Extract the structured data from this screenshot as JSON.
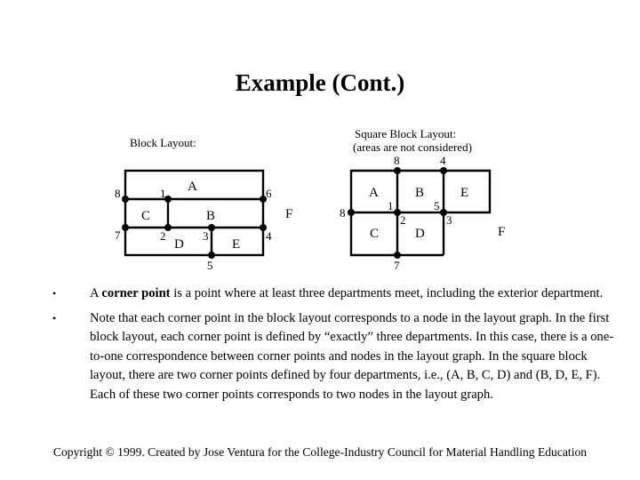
{
  "slide": {
    "title": "Example (Cont.)"
  },
  "block_layout": {
    "caption": "Block Layout:",
    "departments": [
      "A",
      "B",
      "C",
      "D",
      "E",
      "F"
    ],
    "nodes": [
      "1",
      "2",
      "3",
      "4",
      "5",
      "6",
      "7",
      "8"
    ]
  },
  "square_layout": {
    "caption_line1": "Square Block Layout:",
    "caption_line2": "(areas are not considered)",
    "departments": [
      "A",
      "B",
      "C",
      "D",
      "E",
      "F"
    ],
    "node_labels": {
      "top_8": "8",
      "top_4": "4",
      "left_8": "8",
      "center_1": "1",
      "center_2": "2",
      "right_5": "5",
      "right_3": "3",
      "bottom_7": "7"
    }
  },
  "bullets": [
    {
      "marker": "•",
      "pre": "A ",
      "bold": "corner point",
      "post": " is a point where at least three departments meet, including the exterior department."
    },
    {
      "marker": "•",
      "text": "Note that each corner point in the block layout corresponds to a node in the layout graph. In the first block layout, each corner point is defined by “exactly” three departments. In this case, there is a one-to-one correspondence between corner points and nodes in the layout graph. In the square block layout, there are two corner points defined by four departments, i.e., (A, B, C, D) and (B, D, E, F). Each of these two corner points corresponds to two nodes in the layout graph."
    }
  ],
  "footer": {
    "copyright": "Copyright © 1999.  Created by Jose Ventura for the College-Industry Council for Material Handling Education"
  }
}
